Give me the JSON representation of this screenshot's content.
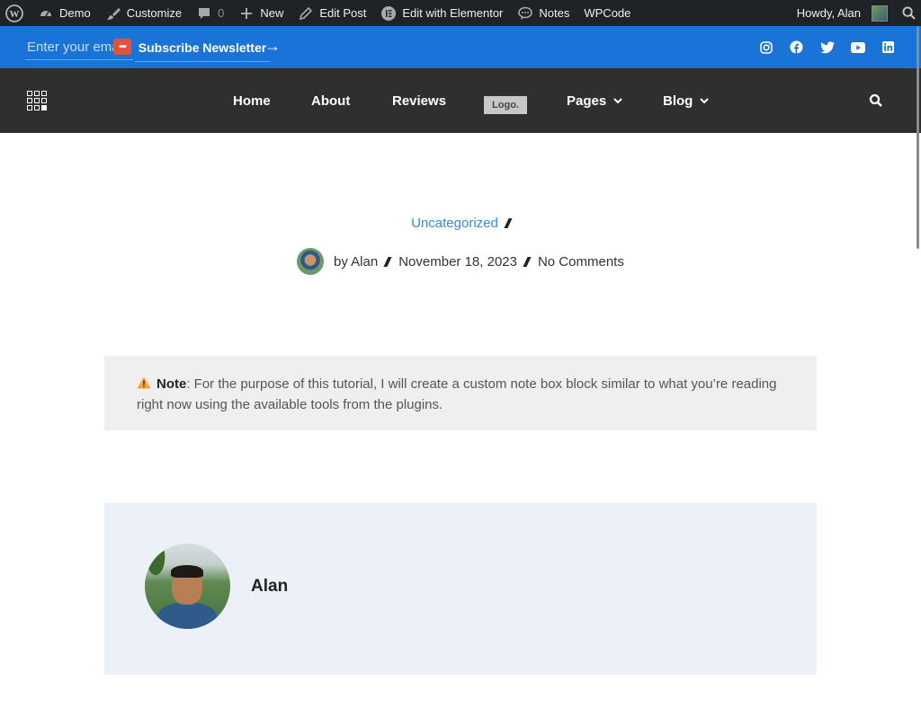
{
  "admin_bar": {
    "site_name": "Demo",
    "customize": "Customize",
    "comments_count": "0",
    "new": "New",
    "edit_post": "Edit Post",
    "edit_elementor": "Edit with Elementor",
    "notes": "Notes",
    "wpcode": "WPCode",
    "howdy": "Howdy, Alan"
  },
  "newsletter": {
    "email_placeholder": "Enter your email",
    "subscribe_label": "Subscribe Newsletter",
    "arrow": "→"
  },
  "nav": {
    "items": [
      "Home",
      "About",
      "Reviews",
      "Pages",
      "Blog"
    ],
    "logo_text": "Logo."
  },
  "post": {
    "category": "Uncategorized",
    "author": "by Alan",
    "date": "November 18, 2023",
    "comments": "No Comments"
  },
  "note": {
    "label": "Note",
    "text": ": For the purpose of this tutorial, I will create a custom note box block similar to what you’re reading right now using the available tools from the plugins."
  },
  "author_box": {
    "name": "Alan"
  },
  "colors": {
    "admin_bar": "#1d2327",
    "newsletter_bar": "#1a73d6",
    "nav_bar": "#2f2f2f",
    "link": "#3a8ad8",
    "note_bg": "#efefef",
    "author_bg": "#ecf0f7"
  }
}
